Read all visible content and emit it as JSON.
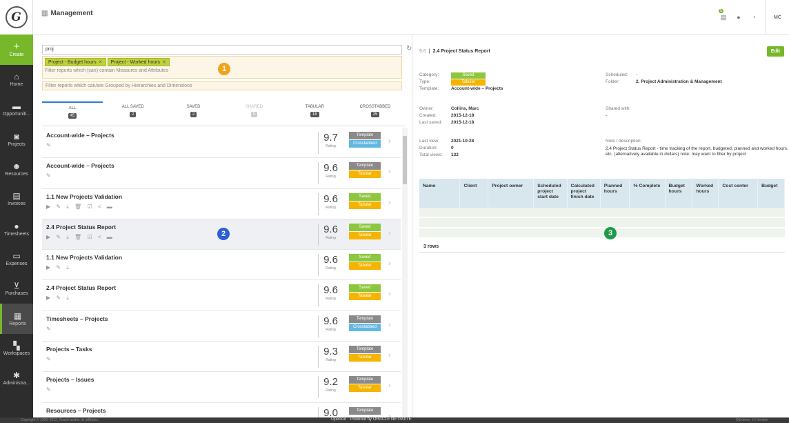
{
  "logo": "G",
  "nav": [
    {
      "label": "Create",
      "icon": "+"
    },
    {
      "label": "Home",
      "icon": "⌂"
    },
    {
      "label": "Opportuniti...",
      "icon": "▬"
    },
    {
      "label": "Projects",
      "icon": "◙"
    },
    {
      "label": "Resources",
      "icon": "☻"
    },
    {
      "label": "Invoices",
      "icon": "▤"
    },
    {
      "label": "Timesheets",
      "icon": "●"
    },
    {
      "label": "Expenses",
      "icon": "▭"
    },
    {
      "label": "Purchases",
      "icon": "⊻"
    },
    {
      "label": "Reports",
      "icon": "▦"
    },
    {
      "label": "Workspaces",
      "icon": "▚"
    },
    {
      "label": "Administra...",
      "icon": "✱"
    }
  ],
  "header": {
    "title": "Management",
    "badge": "5",
    "avatar": "MC"
  },
  "search": {
    "value": "proj"
  },
  "filters": {
    "chips": [
      "Project - Budget hours",
      "Project - Worked hours"
    ],
    "measures_hint": "Filter reports which (can) contain Measures and Attributes",
    "grouped_hint": "Filter reports which can/are Grouped by Hierarchies and Dimensions"
  },
  "callouts": [
    "1",
    "2",
    "3"
  ],
  "tabs": [
    {
      "label": "ALL",
      "count": "45"
    },
    {
      "label": "ALL SAVED",
      "count": "2"
    },
    {
      "label": "SAVED",
      "count": "2"
    },
    {
      "label": "SHARED",
      "count": "0"
    },
    {
      "label": "TABULAR",
      "count": "18"
    },
    {
      "label": "CROSSTABBED",
      "count": "25"
    }
  ],
  "reports": [
    {
      "name": "Account-wide – Projects",
      "rating": "9.7",
      "tag1": "Template",
      "tag2": "Crosstabbed",
      "actions": "✎"
    },
    {
      "name": "Account-wide – Projects",
      "rating": "9.6",
      "tag1": "Template",
      "tag2": "Tabular",
      "actions": "✎"
    },
    {
      "name": "1.1 New Projects Validation",
      "rating": "9.6",
      "tag1": "Saved",
      "tag2": "Tabular",
      "actions": "▶ ✎ ⤓ 🗑  ☑ < ▬"
    },
    {
      "name": "2.4 Project Status Report",
      "rating": "9.6",
      "tag1": "Saved",
      "tag2": "Tabular",
      "actions": "▶ ✎ ⤓ 🗑  ☑ < ▬"
    },
    {
      "name": "1.1 New Projects Validation",
      "rating": "9.6",
      "tag1": "Saved",
      "tag2": "Tabular",
      "actions": "▶ ✎ ⤓"
    },
    {
      "name": "2.4 Project Status Report",
      "rating": "9.6",
      "tag1": "Saved",
      "tag2": "Tabular",
      "actions": "▶ ✎ ⤓"
    },
    {
      "name": "Timesheets – Projects",
      "rating": "9.6",
      "tag1": "Template",
      "tag2": "Crosstabbed",
      "actions": "✎"
    },
    {
      "name": "Projects – Tasks",
      "rating": "9.3",
      "tag1": "Template",
      "tag2": "Tabular",
      "actions": "✎"
    },
    {
      "name": "Projects – Issues",
      "rating": "9.2",
      "tag1": "Template",
      "tag2": "Tabular",
      "actions": "✎"
    },
    {
      "name": "Resources – Projects",
      "rating": "9.0",
      "tag1": "Template",
      "tag2": "",
      "actions": ""
    }
  ],
  "rating_label": "Rating",
  "detail": {
    "id": "9.6",
    "title": "2.4 Project Status Report",
    "edit": "Edit",
    "category_l": "Category:",
    "category": "Saved",
    "type_l": "Type:",
    "type": "Tabular",
    "template_l": "Template:",
    "template": "Account-wide – Projects",
    "scheduled_l": "Scheduled:",
    "scheduled": "-",
    "folder_l": "Folder:",
    "folder": "2. Project Administration & Management",
    "owner_l": "Owner:",
    "owner": "Collins, Marc",
    "created_l": "Created:",
    "created": "2015-12-18",
    "lastsaved_l": "Last saved:",
    "lastsaved": "2015-12-18",
    "shared_l": "Shared with:",
    "shared": "-",
    "lastview_l": "Last view:",
    "lastview": "2021-10-28",
    "duration_l": "Duration:",
    "duration": "0",
    "views_l": "Total views:",
    "views": "132",
    "note_l": "Note / description:",
    "note": "2.4 Project Status Report - time tracking of the report, budgeted, planned and worked hours, etc. (alternatively available in dollars) note: may want to filter by project"
  },
  "grid": {
    "columns": [
      "Name",
      "Client",
      "Project owner",
      "Scheduled project start date",
      "Calculated project finish date",
      "Planned hours",
      "% Complete",
      "Budget hours",
      "Worked hours",
      "Cost center",
      "Budget"
    ],
    "rows": "3 rows"
  },
  "footer": {
    "copyright": "Copyright © 1999–2022, Oracle and/or its affiliates.",
    "center": "OpenAir · Powered by ORACLE NETSUITE",
    "right": "Odrotoon, 14 Version"
  }
}
